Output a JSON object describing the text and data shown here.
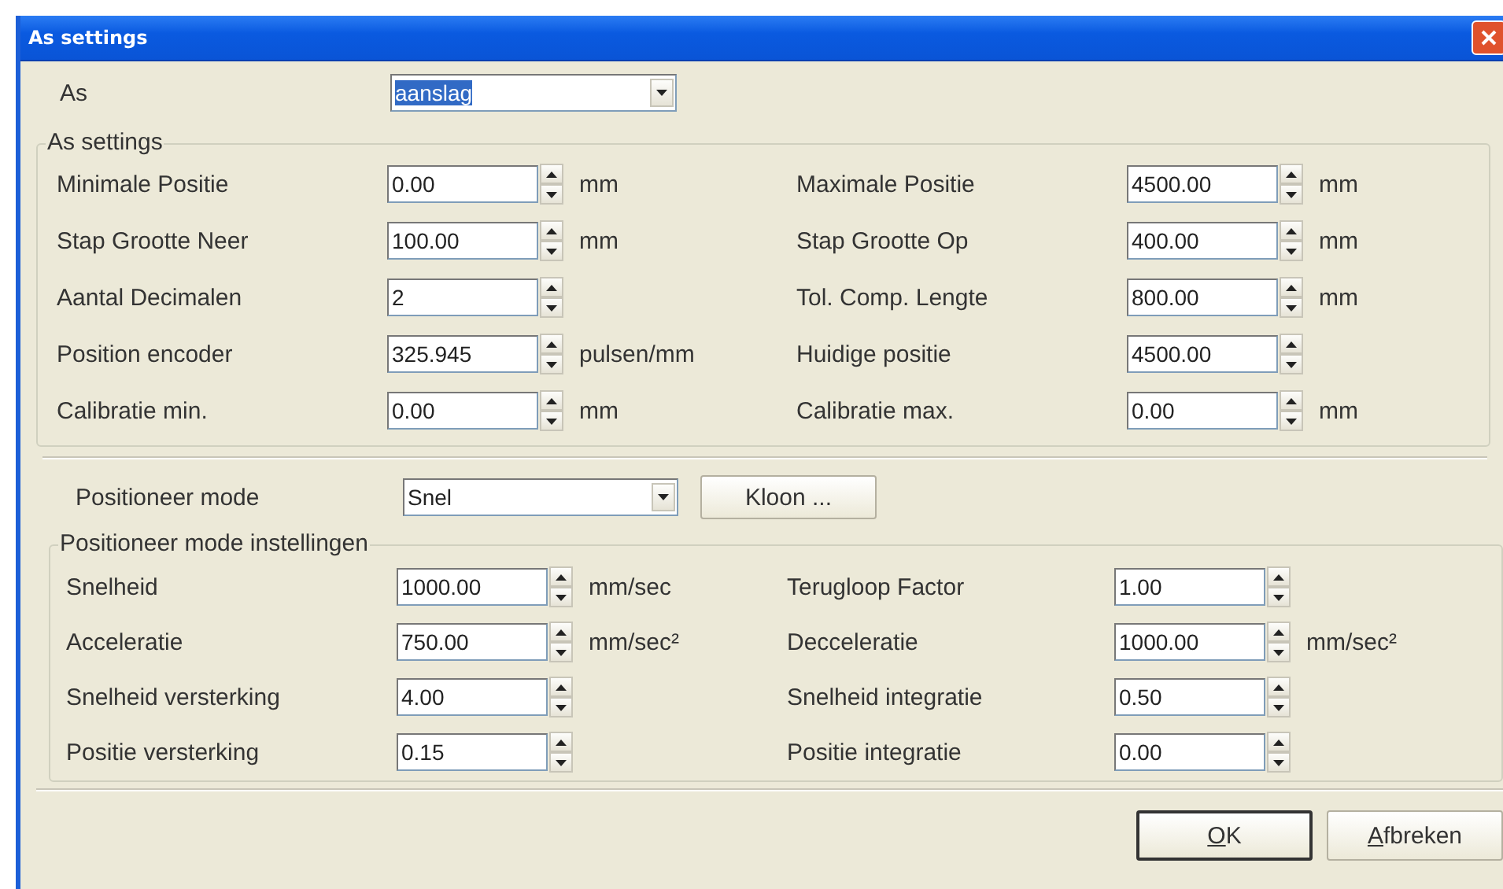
{
  "window": {
    "title": "As settings"
  },
  "axis": {
    "label": "As",
    "value": "aanslag",
    "highlighted": true
  },
  "as_settings": {
    "title": "As settings",
    "left": [
      {
        "label": "Minimale Positie",
        "value": "0.00",
        "unit": "mm"
      },
      {
        "label": "Stap Grootte Neer",
        "value": "100.00",
        "unit": "mm"
      },
      {
        "label": "Aantal Decimalen",
        "value": "2"
      },
      {
        "label": "Position encoder",
        "value": "325.945",
        "unit": "pulsen/mm"
      },
      {
        "label": "Calibratie min.",
        "value": "0.00",
        "unit": "mm"
      }
    ],
    "right": [
      {
        "label": "Maximale Positie",
        "value": "4500.00",
        "unit": "mm"
      },
      {
        "label": "Stap Grootte Op",
        "value": "400.00",
        "unit": "mm"
      },
      {
        "label": "Tol. Comp. Lengte",
        "value": "800.00",
        "unit": "mm"
      },
      {
        "label": "Huidige positie",
        "value": "4500.00"
      },
      {
        "label": "Calibratie max.",
        "value": "0.00",
        "unit": "mm"
      }
    ]
  },
  "mode": {
    "label": "Positioneer mode",
    "value": "Snel",
    "clone_button": "Kloon ..."
  },
  "mode_settings": {
    "title": "Positioneer mode instellingen",
    "left": [
      {
        "label": "Snelheid",
        "value": "1000.00",
        "unit": "mm/sec"
      },
      {
        "label": "Acceleratie",
        "value": "750.00",
        "unit": "mm/sec²"
      },
      {
        "label": "Snelheid versterking",
        "value": "4.00"
      },
      {
        "label": "Positie versterking",
        "value": "0.15"
      }
    ],
    "right": [
      {
        "label": "Terugloop Factor",
        "value": "1.00"
      },
      {
        "label": "Decceleratie",
        "value": "1000.00",
        "unit": "mm/sec²"
      },
      {
        "label": "Snelheid integratie",
        "value": "0.50"
      },
      {
        "label": "Positie integratie",
        "value": "0.00"
      }
    ]
  },
  "buttons": [
    {
      "label": "OK",
      "default": true,
      "mnemonic_underlined": true
    },
    {
      "label": "Afbreken",
      "default": false,
      "mnemonic_underlined": true
    }
  ]
}
